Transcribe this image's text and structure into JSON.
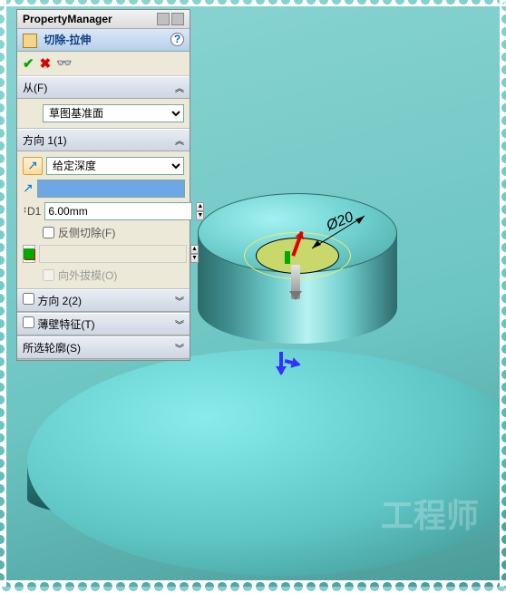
{
  "propertyManager": {
    "title": "PropertyManager",
    "feature": {
      "name": "切除-拉伸",
      "helpGlyph": "?"
    },
    "confirm": {
      "okGlyph": "✔",
      "cancelGlyph": "✖",
      "previewGlyph": "👓"
    }
  },
  "groups": {
    "from": {
      "label": "从(F)",
      "selected": "草图基准面"
    },
    "dir1": {
      "label": "方向 1(1)",
      "endCondition": "给定深度",
      "reverseGlyph": "↗",
      "draftGlyph": "↗",
      "selectedEntity": "",
      "depth": "6.00mm",
      "depthIconLabel": "D1",
      "flipSide": "反侧切除(F)",
      "draftOutward": "向外拔模(O)"
    },
    "dir2": {
      "label": "方向 2(2)"
    },
    "thin": {
      "label": "薄壁特征(T)"
    },
    "contours": {
      "label": "所选轮廓(S)"
    }
  },
  "viewport": {
    "dimension": "Ø20",
    "watermark": "工程师"
  }
}
